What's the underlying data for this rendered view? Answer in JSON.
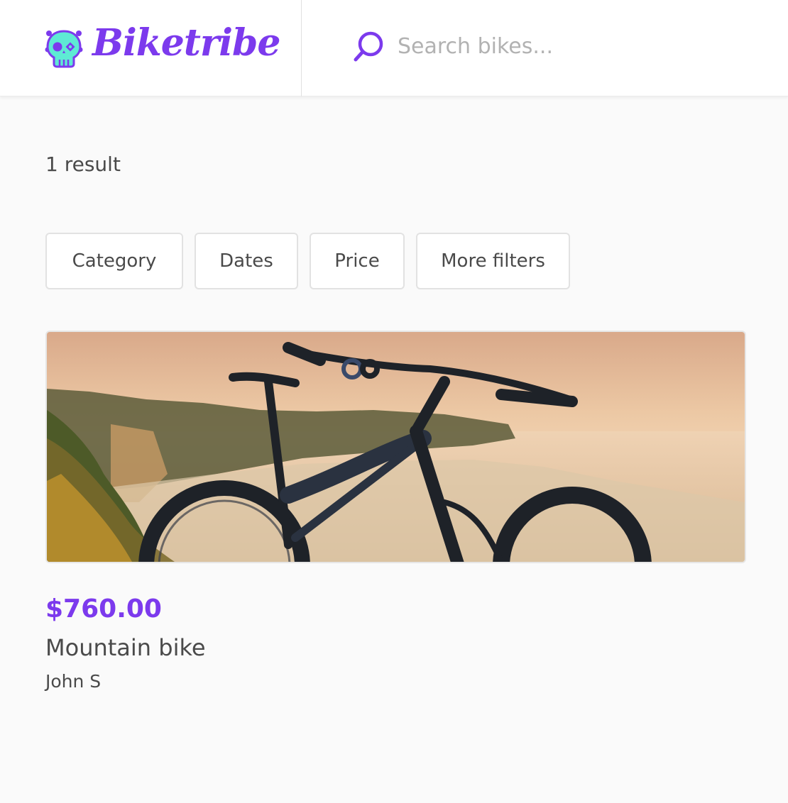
{
  "brand": {
    "name": "Biketribe",
    "logo_icon": "skull-icon",
    "accent_color": "#7c3aed",
    "icon_color": "#5eead4"
  },
  "search": {
    "icon": "search-icon",
    "placeholder": "Search bikes...",
    "value": ""
  },
  "results": {
    "count_label": "1 result"
  },
  "filters": [
    {
      "label": "Category"
    },
    {
      "label": "Dates"
    },
    {
      "label": "Price"
    },
    {
      "label": "More filters"
    }
  ],
  "listings": [
    {
      "image": "mountain-bike-photo",
      "price": "$760.00",
      "title": "Mountain bike",
      "author": "John S"
    }
  ]
}
